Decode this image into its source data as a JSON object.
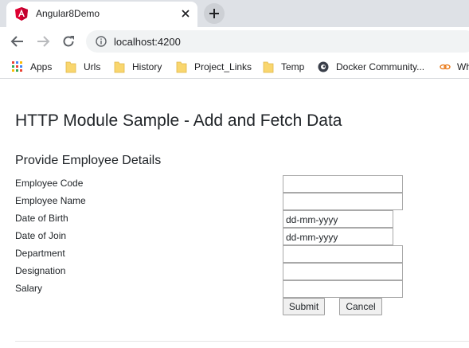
{
  "browser": {
    "tab": {
      "title": "Angular8Demo",
      "favicon": "angular-icon"
    },
    "address_bar": {
      "url": "localhost:4200"
    },
    "bookmarks": [
      {
        "label": "Apps",
        "icon": "apps-grid-icon"
      },
      {
        "label": "Urls",
        "icon": "folder-icon"
      },
      {
        "label": "History",
        "icon": "folder-icon"
      },
      {
        "label": "Project_Links",
        "icon": "folder-icon"
      },
      {
        "label": "Temp",
        "icon": "folder-icon"
      },
      {
        "label": "Docker Community...",
        "icon": "docker-icon"
      },
      {
        "label": "Wh",
        "icon": "link-icon"
      }
    ]
  },
  "page": {
    "title": "HTTP Module Sample - Add and Fetch Data",
    "form_heading": "Provide Employee Details",
    "fields": [
      {
        "label": "Employee Code",
        "type": "text",
        "value": ""
      },
      {
        "label": "Employee Name",
        "type": "text",
        "value": ""
      },
      {
        "label": "Date of Birth",
        "type": "date",
        "value": "dd-mm-yyyy"
      },
      {
        "label": "Date of Join",
        "type": "date",
        "value": "dd-mm-yyyy"
      },
      {
        "label": "Department",
        "type": "text",
        "value": ""
      },
      {
        "label": "Designation",
        "type": "text",
        "value": ""
      },
      {
        "label": "Salary",
        "type": "text",
        "value": ""
      }
    ],
    "buttons": {
      "submit": "Submit",
      "cancel": "Cancel"
    }
  },
  "colors": {
    "tabstrip": "#dee1e6",
    "angular_red": "#dd0031",
    "folder_yellow": "#f9d66e"
  }
}
